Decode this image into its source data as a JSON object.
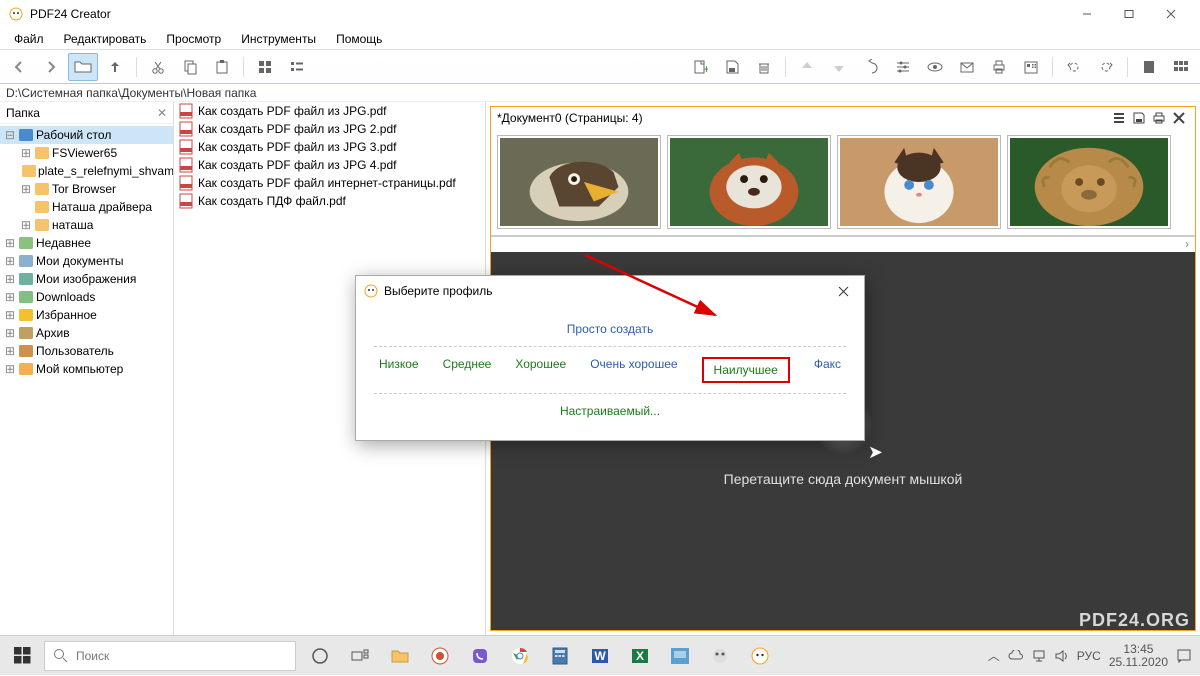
{
  "app": {
    "title": "PDF24 Creator"
  },
  "menu": {
    "file": "Файл",
    "edit": "Редактировать",
    "view": "Просмотр",
    "tools": "Инструменты",
    "help": "Помощь"
  },
  "path": "D:\\Системная папка\\Документы\\Новая папка",
  "left": {
    "header": "Папка",
    "items": [
      {
        "tw": "−",
        "icon": "desktop",
        "label": "Рабочий стол",
        "indent": 0,
        "sel": true
      },
      {
        "tw": "+",
        "icon": "folder",
        "label": "FSViewer65",
        "indent": 1
      },
      {
        "tw": "",
        "icon": "folder",
        "label": "plate_s_relefnymi_shvam",
        "indent": 1
      },
      {
        "tw": "+",
        "icon": "folder",
        "label": "Tor Browser",
        "indent": 1
      },
      {
        "tw": "",
        "icon": "folder",
        "label": "Наташа драйвера",
        "indent": 1
      },
      {
        "tw": "+",
        "icon": "folder",
        "label": "наташа",
        "indent": 1
      },
      {
        "tw": "+",
        "icon": "recent",
        "label": "Недавнее",
        "indent": 0
      },
      {
        "tw": "+",
        "icon": "docs",
        "label": "Мои документы",
        "indent": 0
      },
      {
        "tw": "+",
        "icon": "pics",
        "label": "Мои изображения",
        "indent": 0
      },
      {
        "tw": "+",
        "icon": "down",
        "label": "Downloads",
        "indent": 0
      },
      {
        "tw": "+",
        "icon": "star",
        "label": "Избранное",
        "indent": 0
      },
      {
        "tw": "+",
        "icon": "archive",
        "label": "Архив",
        "indent": 0
      },
      {
        "tw": "+",
        "icon": "user",
        "label": "Пользователь",
        "indent": 0
      },
      {
        "tw": "+",
        "icon": "pc",
        "label": "Мой компьютер",
        "indent": 0
      }
    ]
  },
  "files": [
    "Как создать PDF файл из JPG.pdf",
    "Как создать PDF файл из JPG 2.pdf",
    "Как создать PDF файл из JPG 3.pdf",
    "Как создать PDF файл из JPG 4.pdf",
    "Как создать PDF файл интернет-страницы.pdf",
    "Как создать ПДФ файл.pdf"
  ],
  "doc": {
    "header": "*Документ0 (Страницы: 4)"
  },
  "drop": {
    "text": "Перетащите сюда документ мышкой"
  },
  "dialog": {
    "title": "Выберите профиль",
    "create": "Просто создать",
    "low": "Низкое",
    "med": "Среднее",
    "good": "Хорошее",
    "vgood": "Очень хорошее",
    "best": "Наилучшее",
    "fax": "Факс",
    "custom": "Настраиваемый..."
  },
  "taskbar": {
    "search_placeholder": "Поиск",
    "lang": "РУС",
    "time": "13:45",
    "date": "25.11.2020"
  },
  "watermark": "PDF24.ORG"
}
